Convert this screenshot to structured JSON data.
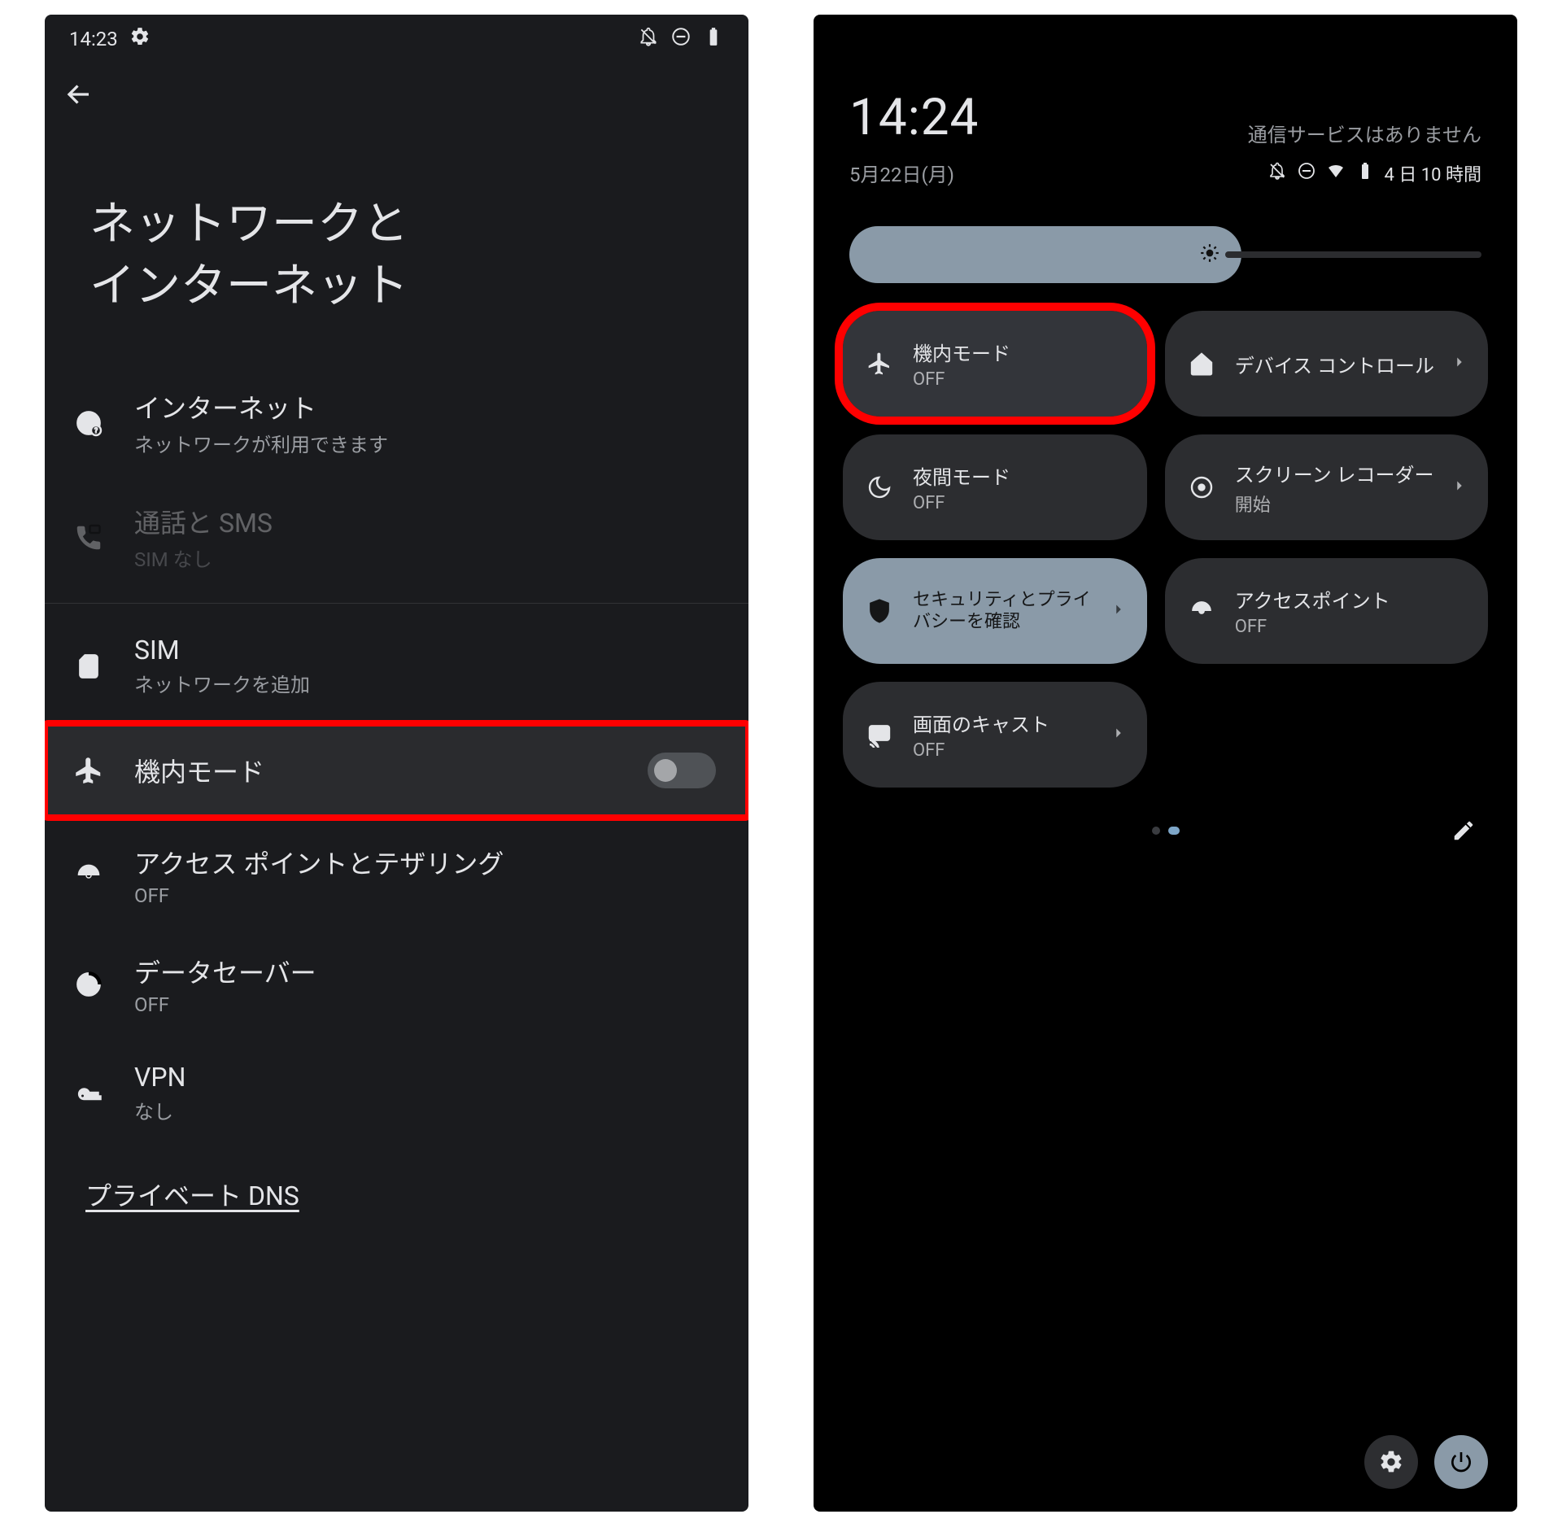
{
  "left": {
    "statusbar": {
      "time": "14:23"
    },
    "title_l1": "ネットワークと",
    "title_l2": "インターネット",
    "items": [
      {
        "title": "インターネット",
        "sub": "ネットワークが利用できます"
      },
      {
        "title": "通話と SMS",
        "sub": "SIM なし"
      },
      {
        "title": "SIM",
        "sub": "ネットワークを追加"
      },
      {
        "title": "機内モード"
      },
      {
        "title": "アクセス ポイントとテザリング",
        "sub": "OFF"
      },
      {
        "title": "データセーバー",
        "sub": "OFF"
      },
      {
        "title": "VPN",
        "sub": "なし"
      },
      {
        "title": "プライベート DNS"
      }
    ]
  },
  "right": {
    "clock": "14:24",
    "service": "通信サービスはありません",
    "date": "5月22日(月)",
    "battery_text": "4 日 10 時間",
    "tiles": {
      "airplane": {
        "title": "機内モード",
        "sub": "OFF"
      },
      "device_ctrl": {
        "title": "デバイス コントロール"
      },
      "night": {
        "title": "夜間モード",
        "sub": "OFF"
      },
      "screen_rec": {
        "title": "スクリーン レコーダー",
        "sub": "開始"
      },
      "security": {
        "title": "セキュリティとプライバシーを確認"
      },
      "hotspot": {
        "title": "アクセスポイント",
        "sub": "OFF"
      },
      "cast": {
        "title": "画面のキャスト",
        "sub": "OFF"
      }
    }
  }
}
